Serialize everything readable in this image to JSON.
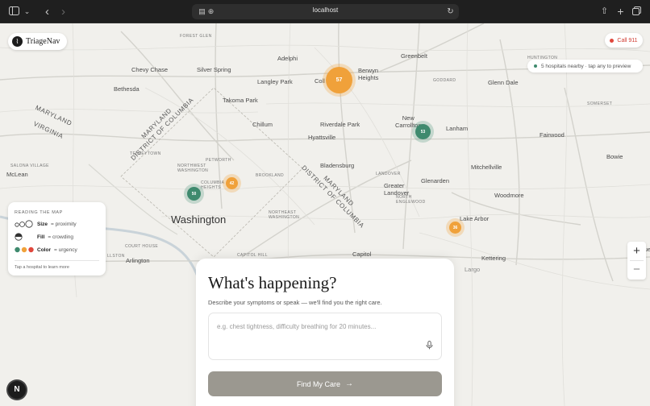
{
  "browser": {
    "url": "localhost",
    "icons": {
      "sidebar": "sidebar-icon",
      "chevron": "chevron-down-icon",
      "back": "back-icon",
      "forward": "forward-icon",
      "reader": "reader-icon",
      "extension": "extension-icon",
      "reload": "reload-icon",
      "share": "share-icon",
      "new_tab": "plus-icon",
      "tabs": "tabs-icon"
    }
  },
  "app": {
    "brand": "TriageNav",
    "call_label": "Call 911",
    "nearby_text": "5 hospitals nearby · tap any to preview"
  },
  "map": {
    "places": {
      "forest_glen": "FOREST GLEN",
      "adelphi": "Adelphi",
      "greenbelt": "Greenbelt",
      "huntington": "HUNTINGTON",
      "chevy_chase": "Chevy Chase",
      "silver_spring": "Silver Spring",
      "berwyn_heights": "Berwyn\nHeights",
      "college_park": "Coll",
      "langley_park": "Langley Park",
      "goddard": "GODDARD",
      "glenn_dale": "Glenn Dale",
      "bethesda": "Bethesda",
      "takoma_park": "Takoma Park",
      "somerset": "SOMERSET",
      "maryland_w": "MARYLAND",
      "virginia": "VIRGINIA",
      "md_dc": "MARYLAND\nDISTRICT OF COLUMBIA",
      "chillum": "Chillum",
      "riverdale_park": "Riverdale Park",
      "new_carrollton": "New\nCarrollton",
      "lanham": "Lanham",
      "fairwood": "Fairwood",
      "hyattsville": "Hyattsville",
      "bowie": "Bowie",
      "tenleytown": "TENLEYTOWN",
      "salona_village": "SALONA VILLAGE",
      "petworth": "PETWORTH",
      "mclean": "McLean",
      "northwest_washington": "NORTHWEST\nWASHINGTON",
      "bladensburg": "Bladensburg",
      "mitchellville": "Mitchellville",
      "brookland": "BROOKLAND",
      "landover": "LANDOVER",
      "glenarden": "Glenarden",
      "columbia_heights": "COLUMBIA\nHEIGHTS",
      "md_dc_2": "MARYLAND\nDISTRICT OF COLUMBIA",
      "greater_landover": "Greater\nLandover",
      "north_englewood": "NORTH\nENGLEWOOD",
      "woodmore": "Woodmore",
      "washington": "Washington",
      "northeast_washington": "NORTHEAST\nWASHINGTON",
      "lake_arbor": "Lake Arbor",
      "court_house": "COURT HOUSE",
      "arlington": "Arlington",
      "ullston": "LLSTON",
      "capitol_hill": "CAPITOL HILL",
      "capitol": "Capitol",
      "kettering": "Kettering",
      "largo": "Largo",
      "queens": "Que\nn"
    },
    "hospitals": [
      {
        "label": "57",
        "urgency": "orange"
      },
      {
        "label": "53",
        "urgency": "green"
      },
      {
        "label": "50",
        "urgency": "green"
      },
      {
        "label": "42",
        "urgency": "orange"
      },
      {
        "label": "36",
        "urgency": "orange"
      }
    ],
    "zoom_in": "+",
    "zoom_out": "−",
    "dev_badge": "N"
  },
  "legend": {
    "title": "READING THE MAP",
    "size_key": "Size",
    "size_val": "= proximity",
    "fill_key": "Fill",
    "fill_val": "= crowding",
    "color_key": "Color",
    "color_val": "= urgency",
    "tap_hint": "Tap a hospital to learn more"
  },
  "card": {
    "title": "What's happening?",
    "subtitle": "Describe your symptoms or speak — we'll find you the right care.",
    "placeholder": "e.g. chest tightness, difficulty breathing for 20 minutes...",
    "button_label": "Find My Care",
    "button_arrow": "→",
    "mic_icon": "mic-icon"
  },
  "colors": {
    "green": "#3f8a6e",
    "orange": "#f0a13a",
    "red": "#e0483d"
  }
}
